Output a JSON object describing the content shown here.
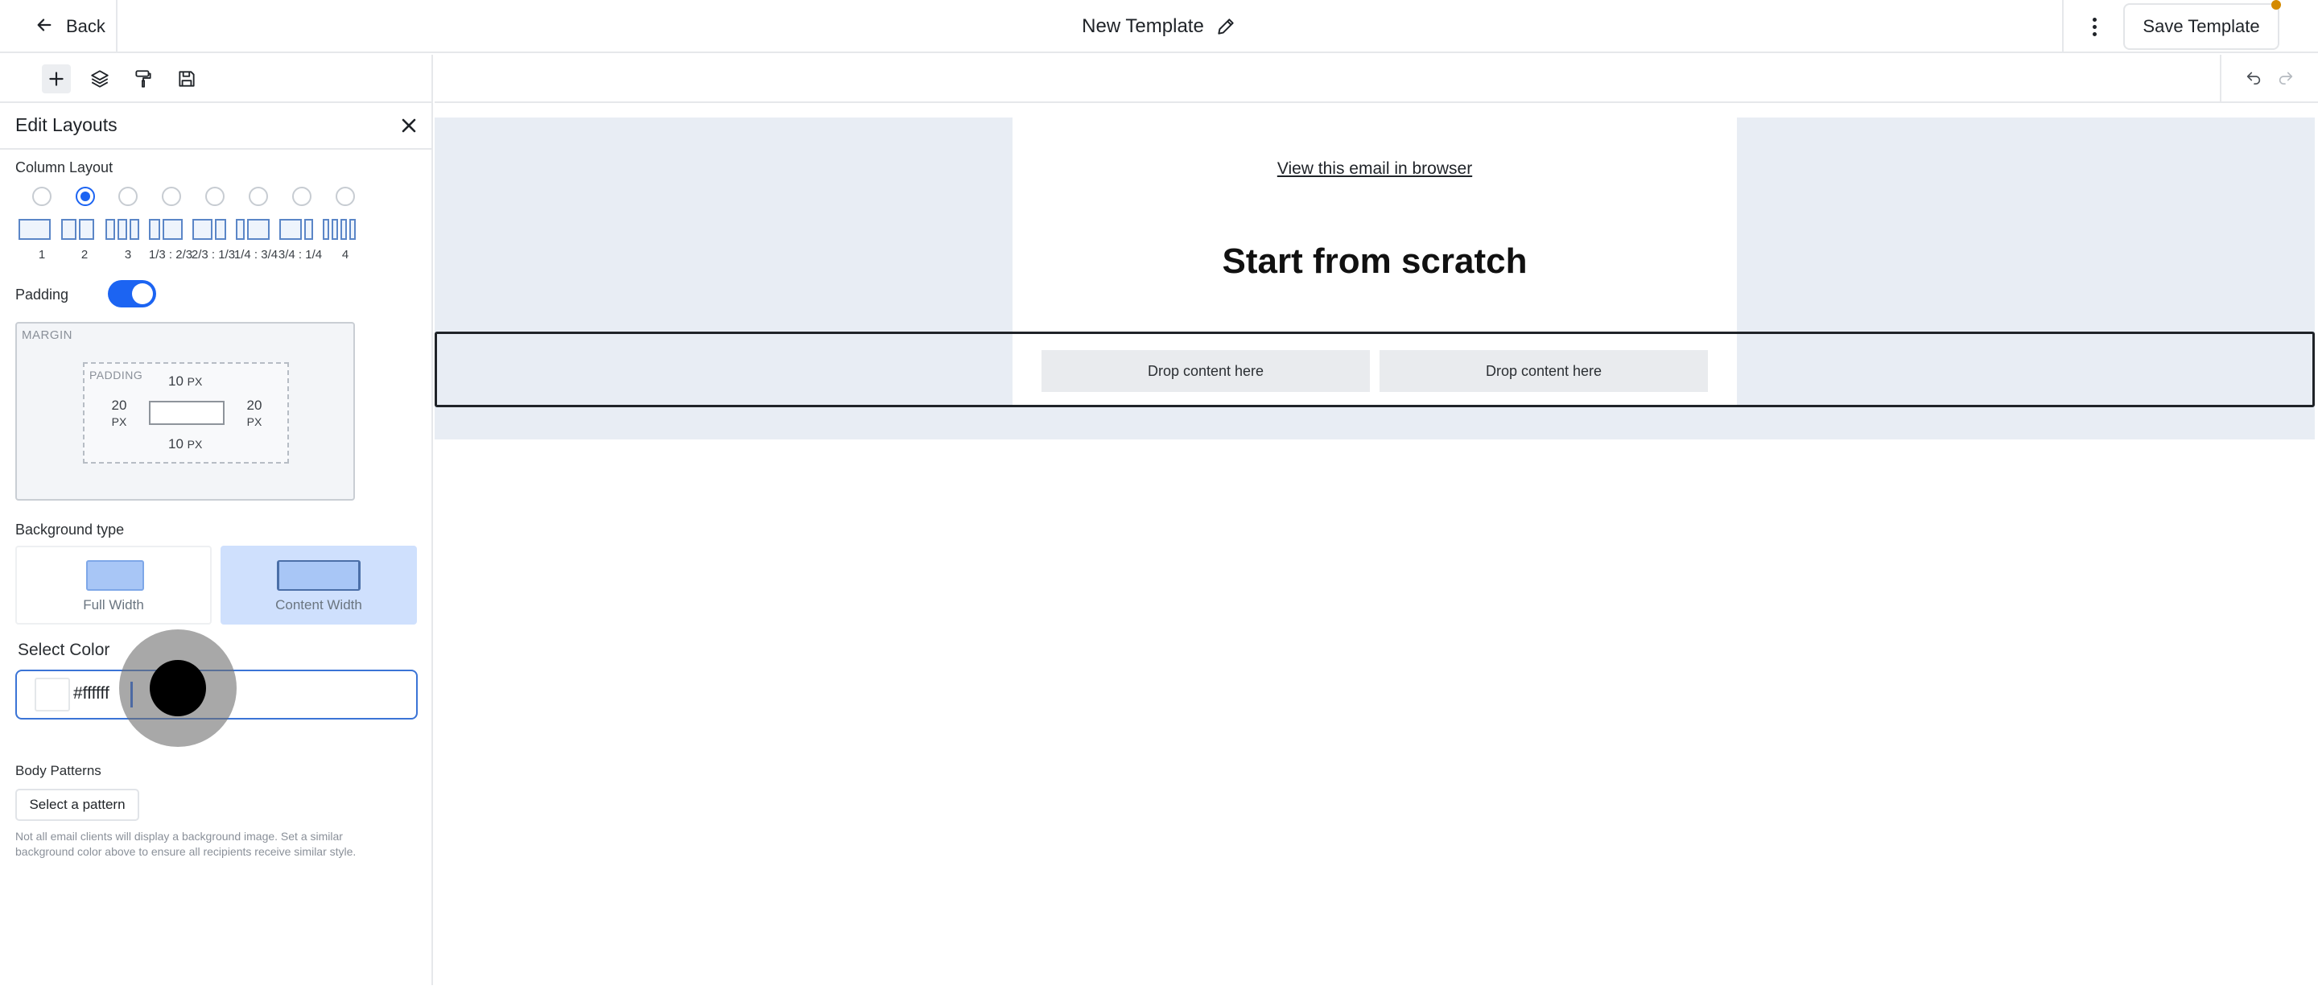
{
  "header": {
    "back_label": "Back",
    "title": "New Template",
    "save_label": "Save Template"
  },
  "toolbar": {
    "tools": [
      "add-icon",
      "layers-icon",
      "paint-roller-icon",
      "save-icon"
    ],
    "undo_icon": "undo-icon",
    "redo_icon": "redo-icon"
  },
  "panel": {
    "title": "Edit Layouts",
    "column_layout_label": "Column Layout",
    "layouts": [
      {
        "label": "1",
        "selected": false
      },
      {
        "label": "2",
        "selected": true
      },
      {
        "label": "3",
        "selected": false
      },
      {
        "label": "1/3 : 2/3",
        "selected": false
      },
      {
        "label": "2/3 : 1/3",
        "selected": false
      },
      {
        "label": "1/4 : 3/4",
        "selected": false
      },
      {
        "label": "3/4 : 1/4",
        "selected": false
      },
      {
        "label": "4",
        "selected": false
      }
    ],
    "padding_label": "Padding",
    "padding_enabled": true,
    "margin_label": "MARGIN",
    "padding_box_label": "PADDING",
    "padding": {
      "top": "10",
      "bottom": "10",
      "left": "20",
      "right": "20",
      "unit": "PX"
    },
    "background_type_label": "Background type",
    "background_options": [
      "Full Width",
      "Content Width"
    ],
    "background_selected": "Content Width",
    "select_color_label": "Select Color",
    "color_value": "#ffffff",
    "body_patterns_label": "Body Patterns",
    "pattern_button": "Select a pattern",
    "note": "Not all email clients will display a background image. Set a similar background color above to ensure all recipients receive similar style."
  },
  "canvas": {
    "view_in_browser": "View this email in browser",
    "heading": "Start from scratch",
    "drop_zones": [
      "Drop content here",
      "Drop content here"
    ]
  },
  "colors": {
    "accent": "#1c64f2",
    "canvas_bg": "#e8edf4",
    "notification": "#d48a00"
  }
}
